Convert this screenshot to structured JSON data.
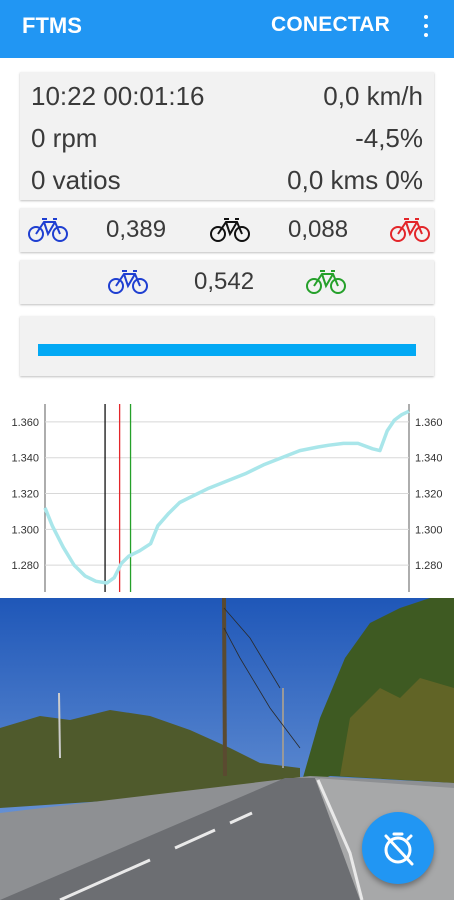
{
  "appbar": {
    "title": "FTMS",
    "connect_label": "CONECTAR",
    "menu_icon": "more-vert-icon"
  },
  "stats": {
    "clock": "10:22 00:01:16",
    "speed": "0,0 km/h",
    "cadence": "0 rpm",
    "grade": "-4,5%",
    "power": "0 vatios",
    "distance": "0,0 kms 0%"
  },
  "riders": {
    "gap_blue": "0,389",
    "gap_black": "0,088",
    "gap_total": "0,542"
  },
  "colors": {
    "accent": "#2196f3",
    "blue_bike": "#1f3fd1",
    "black_bike": "#111111",
    "red_bike": "#e3262a",
    "green_bike": "#25a02a",
    "profile": "#a9e6ea"
  },
  "progress": {
    "fraction": 1.0
  },
  "chart_data": {
    "type": "line",
    "title": "",
    "xlabel": "",
    "ylabel": "",
    "ylim": [
      1.265,
      1.37
    ],
    "yticks": [
      "1.280",
      "1.300",
      "1.320",
      "1.340",
      "1.360"
    ],
    "ytick_values": [
      1.28,
      1.3,
      1.32,
      1.34,
      1.36
    ],
    "grid": true,
    "markers": [
      {
        "name": "black",
        "x": 0.165
      },
      {
        "name": "red",
        "x": 0.205
      },
      {
        "name": "green",
        "x": 0.235
      }
    ],
    "series": [
      {
        "x": [
          0.0,
          0.02,
          0.05,
          0.08,
          0.11,
          0.14,
          0.17,
          0.19,
          0.21,
          0.23,
          0.26,
          0.29,
          0.31,
          0.34,
          0.37,
          0.4,
          0.45,
          0.5,
          0.55,
          0.6,
          0.65,
          0.7,
          0.75,
          0.78,
          0.82,
          0.86,
          0.9,
          0.92,
          0.94,
          0.96,
          0.98,
          1.0
        ],
        "values": [
          1.312,
          1.302,
          1.29,
          1.28,
          1.274,
          1.271,
          1.27,
          1.273,
          1.281,
          1.285,
          1.288,
          1.292,
          1.302,
          1.309,
          1.315,
          1.318,
          1.323,
          1.327,
          1.331,
          1.336,
          1.34,
          1.344,
          1.346,
          1.347,
          1.348,
          1.348,
          1.345,
          1.344,
          1.355,
          1.361,
          1.364,
          1.366
        ]
      }
    ]
  }
}
